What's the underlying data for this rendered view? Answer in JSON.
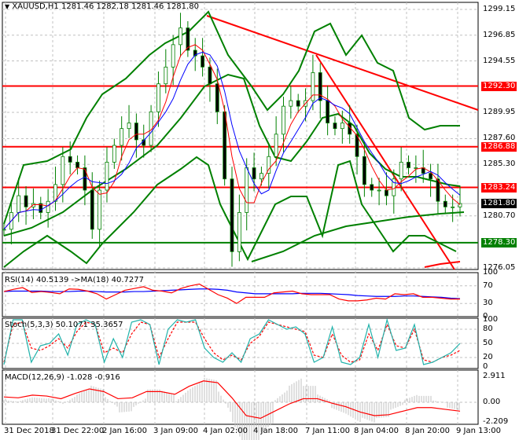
{
  "header": {
    "symbol": "XAUUSD,H1",
    "ohlc": "1281.46 1282.18 1281.46 1281.80"
  },
  "price_axis": [
    "1299.15",
    "1296.85",
    "1294.55",
    "1289.95",
    "1287.60",
    "1285.30",
    "1280.70",
    "1276.05"
  ],
  "levels": [
    {
      "label": "1292.30",
      "value": 1292.3,
      "color": "#ff0000"
    },
    {
      "label": "1286.88",
      "value": 1286.88,
      "color": "#ff0000"
    },
    {
      "label": "1283.24",
      "value": 1283.24,
      "color": "#ff0000"
    },
    {
      "label": "1278.30",
      "value": 1278.3,
      "color": "#008000"
    }
  ],
  "current_price": {
    "label": "1281.80",
    "value": 1281.8
  },
  "rsi": {
    "title": "RSI(14) 40.5139  ->MA(18) 40.7277",
    "axis": [
      "100",
      "70",
      "30",
      "0"
    ]
  },
  "stoch": {
    "title": "Stoch(5,3,3) 50.1071 35.3657",
    "axis": [
      "100",
      "80",
      "50",
      "20",
      "0"
    ]
  },
  "macd": {
    "title": "MACD(12,26,9) -1.028 -0.916",
    "axis": [
      "2.911",
      "0.00",
      "-2.209"
    ]
  },
  "time_axis": [
    "31 Dec 2018",
    "31 Dec 22:00",
    "2 Jan 16:00",
    "3 Jan 09:00",
    "4 Jan 02:00",
    "4 Jan 18:00",
    "7 Jan 11:00",
    "8 Jan 04:00",
    "8 Jan 20:00",
    "9 Jan 13:00"
  ],
  "chart_data": {
    "type": "line",
    "price_closes": [
      1279.5,
      1281,
      1282.5,
      1281.5,
      1281.8,
      1281,
      1282,
      1283.5,
      1286,
      1285.5,
      1285,
      1283,
      1279.5,
      1283,
      1285.5,
      1287,
      1288.5,
      1289,
      1287.5,
      1287,
      1290,
      1292.5,
      1294,
      1296,
      1297.5,
      1295.5,
      1295,
      1294,
      1292.5,
      1290,
      1284,
      1277.5,
      1281,
      1285,
      1284,
      1284.5,
      1286,
      1288,
      1290.5,
      1291,
      1290.5,
      1291,
      1293.5,
      1291,
      1289,
      1288.5,
      1289,
      1288,
      1286,
      1283.5,
      1283,
      1283,
      1282.5,
      1284,
      1285.5,
      1285,
      1285,
      1284.5,
      1284,
      1282,
      1281.5,
      1281.5,
      1281.8
    ],
    "rsi": [
      57,
      62,
      66,
      55,
      57,
      55,
      52,
      63,
      62,
      58,
      52,
      40,
      50,
      60,
      64,
      68,
      60,
      58,
      54,
      64,
      70,
      74,
      62,
      50,
      42,
      30,
      44,
      44,
      44,
      54,
      56,
      58,
      52,
      50,
      50,
      50,
      40,
      36,
      36,
      38,
      42,
      40,
      52,
      50,
      52,
      44,
      44,
      42,
      40,
      40
    ],
    "rsi_ma": [
      57,
      58,
      58,
      58,
      58,
      57,
      57,
      57,
      58,
      58,
      57,
      56,
      56,
      56,
      57,
      57,
      58,
      59,
      60,
      61,
      62,
      63,
      63,
      62,
      60,
      56,
      54,
      52,
      52,
      52,
      52,
      52,
      53,
      53,
      53,
      52,
      51,
      50,
      48,
      47,
      46,
      46,
      46,
      47,
      47,
      46,
      45,
      44,
      42,
      41
    ],
    "stoch_k": [
      5,
      100,
      100,
      10,
      45,
      50,
      70,
      25,
      90,
      100,
      90,
      10,
      60,
      20,
      95,
      100,
      90,
      5,
      80,
      100,
      95,
      100,
      40,
      20,
      10,
      30,
      10,
      60,
      70,
      100,
      90,
      80,
      85,
      70,
      10,
      20,
      85,
      10,
      5,
      20,
      90,
      20,
      100,
      35,
      40,
      90,
      5,
      10,
      20,
      30,
      50
    ],
    "stoch_d": [
      10,
      90,
      95,
      40,
      35,
      45,
      60,
      40,
      75,
      95,
      90,
      30,
      40,
      30,
      70,
      95,
      90,
      20,
      60,
      95,
      95,
      95,
      60,
      30,
      15,
      25,
      15,
      50,
      65,
      95,
      90,
      85,
      80,
      75,
      25,
      20,
      70,
      25,
      10,
      15,
      70,
      35,
      90,
      45,
      40,
      80,
      15,
      10,
      20,
      25,
      35
    ],
    "macd": [
      0.6,
      0.5,
      0.8,
      0.7,
      0.4,
      1.0,
      1.5,
      1.2,
      0.4,
      0.5,
      1.2,
      1.2,
      0.9,
      1.8,
      2.4,
      2.2,
      0.5,
      -1.5,
      -1.8,
      -1.0,
      -0.2,
      0.4,
      0.4,
      -0.1,
      -0.5,
      -1.1,
      -1.5,
      -1.4,
      -1.0,
      -0.6,
      -0.6,
      -0.8,
      -1.0
    ],
    "ylim_price": [
      1276.05,
      1299.15
    ],
    "ylim_macd": [
      -2.209,
      2.911
    ]
  }
}
